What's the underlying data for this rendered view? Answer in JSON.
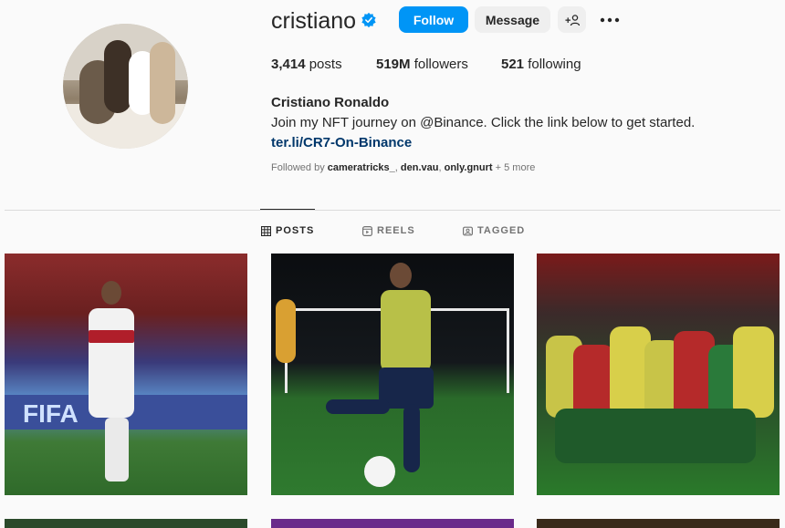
{
  "profile": {
    "username": "cristiano",
    "verified_icon": "verified-badge-icon",
    "follow_label": "Follow",
    "message_label": "Message",
    "add_user_icon": "add-user-icon",
    "more_icon": "more-options-icon"
  },
  "stats": {
    "posts_count": "3,414",
    "posts_label": "posts",
    "followers_count": "519M",
    "followers_label": "followers",
    "following_count": "521",
    "following_label": "following"
  },
  "bio": {
    "full_name": "Cristiano Ronaldo",
    "text": "Join my NFT journey on @Binance. Click the link below to get started.",
    "link": "ter.li/CR7-On-Binance",
    "followed_by_prefix": "Followed by",
    "followers": [
      "cameratricks_",
      "den.vau",
      "only.gnurt"
    ],
    "more": "+ 5 more"
  },
  "tabs": [
    {
      "label": "POSTS",
      "icon": "grid-icon",
      "active": true
    },
    {
      "label": "REELS",
      "icon": "reels-icon",
      "active": false
    },
    {
      "label": "TAGGED",
      "icon": "tagged-icon",
      "active": false
    }
  ],
  "colors": {
    "accent": "#0095f6",
    "link": "#00376b",
    "verified": "#0095f6"
  },
  "posts": [
    {
      "alt_icon": "post-image"
    },
    {
      "alt_icon": "post-image"
    },
    {
      "alt_icon": "post-image"
    },
    {
      "alt_icon": "post-image"
    },
    {
      "alt_icon": "post-image"
    },
    {
      "alt_icon": "post-image"
    }
  ]
}
